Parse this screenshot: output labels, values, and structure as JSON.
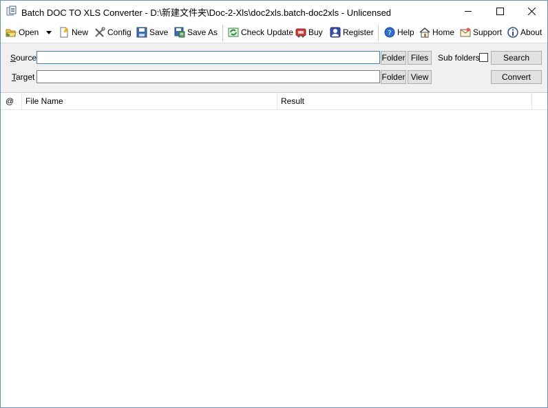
{
  "window": {
    "title": "Batch DOC TO XLS Converter - D:\\新建文件夹\\Doc-2-Xls\\doc2xls.batch-doc2xls - Unlicensed"
  },
  "toolbar": {
    "open": "Open",
    "new": "New",
    "config": "Config",
    "save": "Save",
    "save_as": "Save As",
    "check_update": "Check Update",
    "buy": "Buy",
    "register": "Register",
    "help": "Help",
    "home": "Home",
    "support": "Support",
    "about": "About"
  },
  "form": {
    "source_label_key": "S",
    "source_label_rest": "ource",
    "source_value": "",
    "target_label_key": "T",
    "target_label_rest": "arget",
    "target_value": "",
    "folder_label": "Folder",
    "files_label": "Files",
    "view_label": "View",
    "sub_folders_label": "Sub folders",
    "sub_folders_checked": false,
    "search_label": "Search",
    "convert_label": "Convert"
  },
  "list": {
    "columns": [
      "@",
      "File Name",
      "Result"
    ],
    "rows": []
  }
}
